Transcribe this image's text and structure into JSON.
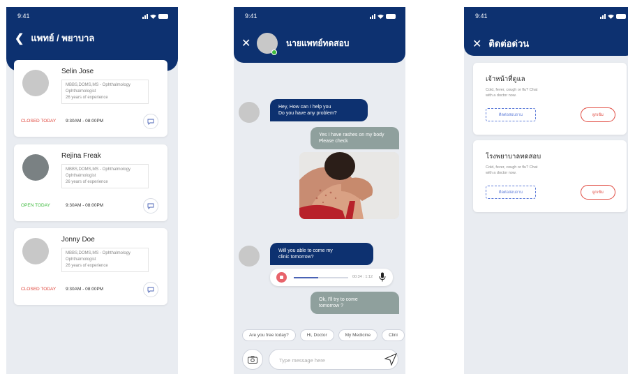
{
  "status_time": "9:41",
  "colors": {
    "primary": "#0d3170",
    "closed": "#e0483e",
    "open": "#3dbb3d",
    "bubble_out": "#8fa09d"
  },
  "doctors_screen": {
    "title": "แพทย์ / พยาบาล",
    "doctors": [
      {
        "name": "Selin Jose",
        "degree": "MBBS,DOMS,MS - Ophthalmology",
        "specialty": "Ophthalmologist",
        "experience": "26 years of experience",
        "status": "CLOSED TODAY",
        "hours": "9:30AM - 08:00PM"
      },
      {
        "name": "Rejina Freak",
        "degree": "MBBS,DOMS,MS - Ophthalmology",
        "specialty": "Ophthalmologist",
        "experience": "26 years of experience",
        "status": "OPEN TODAY",
        "hours": "9:30AM - 08:00PM"
      },
      {
        "name": "Jonny Doe",
        "degree": "MBBS,DOMS,MS - Ophthalmology",
        "specialty": "Ophthalmologist",
        "experience": "26 years of experience",
        "status": "CLOSED TODAY",
        "hours": "9:30AM - 08:00PM"
      }
    ]
  },
  "chat_screen": {
    "contact_name": "นายแพทย์ทดสอบ",
    "messages": [
      {
        "from": "doctor",
        "line1": "Hey, How can I help you",
        "line2": "Do you have any problem?"
      },
      {
        "from": "user",
        "line1": "Yes I have rashes on my body",
        "line2": "Please check"
      },
      {
        "from": "doctor",
        "line1": "Will you able to come my",
        "line2": "clinic tomorrow?"
      },
      {
        "from": "user",
        "line1": "Ok, I'll try to come",
        "line2": "tomorrow ?"
      }
    ],
    "audio": {
      "time": "00:34 : 1:12",
      "progress": 0.45
    },
    "quick_replies": [
      "Are you free today?",
      "Hi, Doctor",
      "My Medicine",
      "Clini"
    ],
    "input_placeholder": "Type message here"
  },
  "emergency_screen": {
    "title": "ติดต่อด่วน",
    "cards": [
      {
        "title": "เจ้าหน้าที่ดูแล",
        "desc1": "Cold, fever, cough or flu? Chat",
        "desc2": "with a doctor now.",
        "contact_btn": "ติดต่อสอบถาม",
        "book_btn": "ผูกเข้ม"
      },
      {
        "title": "โรงพยาบาลทดสอบ",
        "desc1": "Cold, fever, cough or flu? Chat",
        "desc2": "with a doctor now.",
        "contact_btn": "ติดต่อสอบถาม",
        "book_btn": "ผูกเข้ม"
      }
    ]
  }
}
